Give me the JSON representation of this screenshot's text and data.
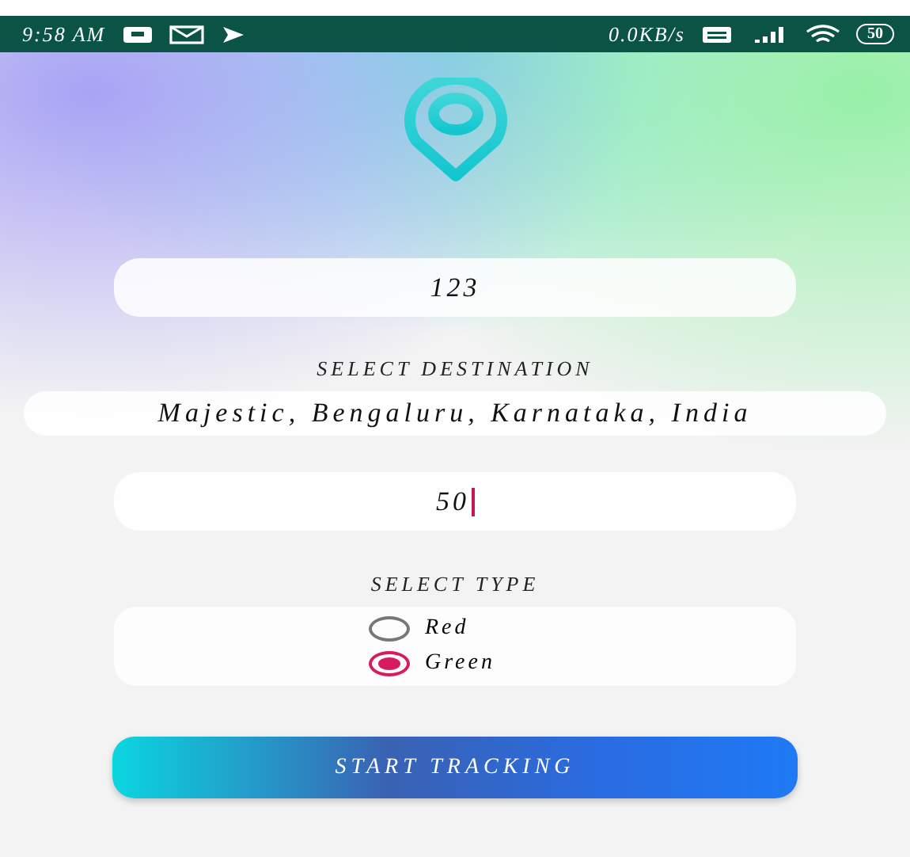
{
  "status_bar": {
    "time": "9:58 AM",
    "network_speed": "0.0KB/s",
    "battery": "50"
  },
  "vehicle_field": {
    "value": "123",
    "focused": false
  },
  "destination": {
    "label": "SELECT DESTINATION",
    "value": "Majestic, Bengaluru, Karnataka, India"
  },
  "distance_field": {
    "value": "50",
    "focused": true
  },
  "type": {
    "label": "SELECT TYPE",
    "options": [
      {
        "label": "Red",
        "selected": false
      },
      {
        "label": "Green",
        "selected": true
      }
    ]
  },
  "button": "START TRACKING"
}
